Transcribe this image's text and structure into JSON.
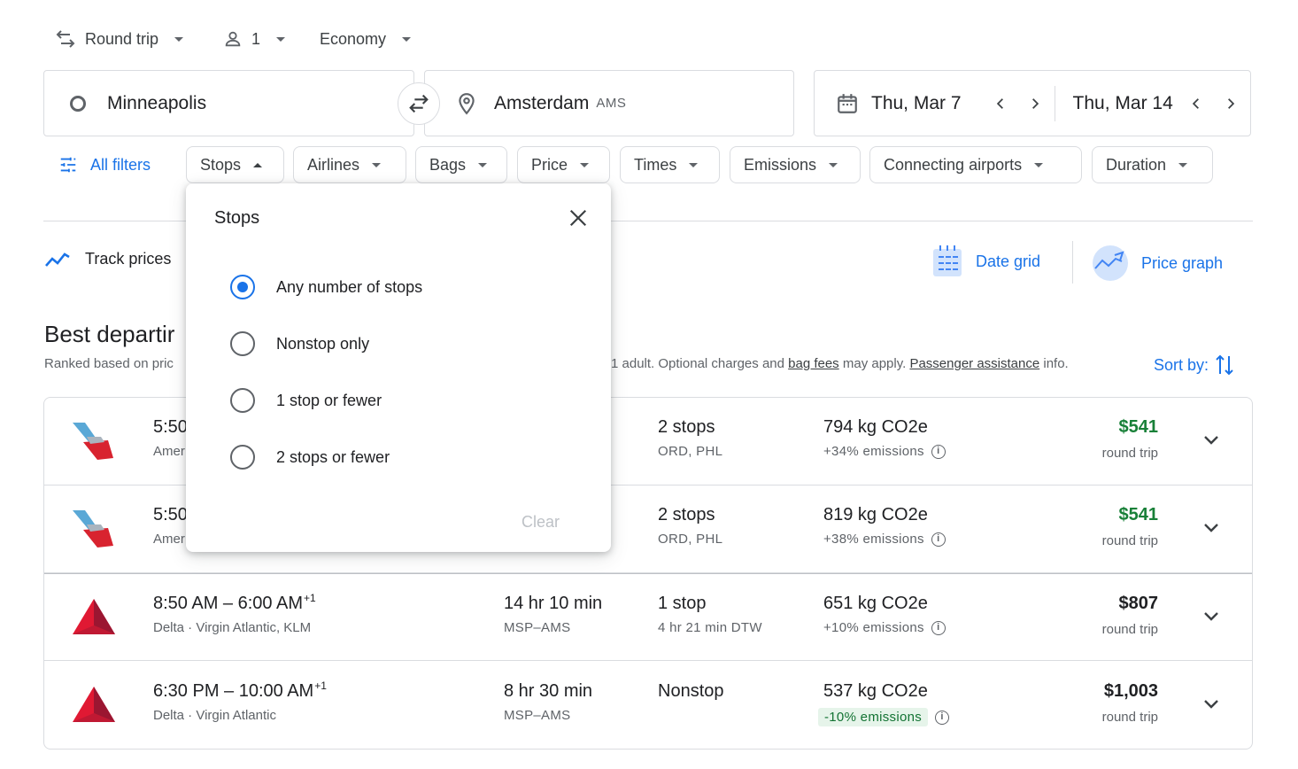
{
  "trip_options": {
    "trip_type": "Round trip",
    "passengers": "1",
    "cabin": "Economy"
  },
  "search": {
    "origin": "Minneapolis",
    "destination": "Amsterdam",
    "destination_code": "AMS",
    "depart_date": "Thu, Mar 7",
    "return_date": "Thu, Mar 14"
  },
  "filters": {
    "all_filters": "All filters",
    "chips": [
      "Stops",
      "Airlines",
      "Bags",
      "Price",
      "Times",
      "Emissions",
      "Connecting airports",
      "Duration"
    ]
  },
  "tools": {
    "track_prices": "Track prices",
    "date_grid": "Date grid",
    "price_graph": "Price graph"
  },
  "results_header": {
    "title": "Best departir",
    "ranked_prefix": "Ranked based on pric",
    "ranked_suffix_1": "1 adult. Optional charges and ",
    "bag_fees": "bag fees",
    "ranked_suffix_2": " may apply. ",
    "passenger_assistance": "Passenger assistance",
    "ranked_suffix_3": " info.",
    "sort_by": "Sort by:"
  },
  "flights": [
    {
      "times": "5:50",
      "plus": "",
      "airline": "Amer",
      "duration": "",
      "route": "",
      "stops": "2 stops",
      "stop_detail": "ORD, PHL",
      "co2": "794 kg CO2e",
      "emissions": "+34% emissions",
      "price": "$541",
      "price_type": "round trip"
    },
    {
      "times": "5:50",
      "plus": "",
      "airline": "Amer",
      "duration": "",
      "route": "",
      "stops": "2 stops",
      "stop_detail": "ORD, PHL",
      "co2": "819 kg CO2e",
      "emissions": "+38% emissions",
      "price": "$541",
      "price_type": "round trip"
    },
    {
      "times": "8:50 AM – 6:00 AM",
      "plus": "+1",
      "airline": "Delta · Virgin Atlantic, KLM",
      "duration": "14 hr 10 min",
      "route": "MSP–AMS",
      "stops": "1 stop",
      "stop_detail": "4 hr 21 min DTW",
      "co2": "651 kg CO2e",
      "emissions": "+10% emissions",
      "price": "$807",
      "price_type": "round trip"
    },
    {
      "times": "6:30 PM – 10:00 AM",
      "plus": "+1",
      "airline": "Delta · Virgin Atlantic",
      "duration": "8 hr 30 min",
      "route": "MSP–AMS",
      "stops": "Nonstop",
      "stop_detail": "",
      "co2": "537 kg CO2e",
      "emissions": "-10% emissions",
      "price": "$1,003",
      "price_type": "round trip"
    }
  ],
  "stops_popover": {
    "title": "Stops",
    "options": [
      "Any number of stops",
      "Nonstop only",
      "1 stop or fewer",
      "2 stops or fewer"
    ],
    "selected": "Any number of stops",
    "clear": "Clear"
  },
  "colors": {
    "accent": "#1a73e8",
    "price_green": "#188038",
    "emission_badge_bg": "#e6f4ea",
    "emission_badge_text": "#137333"
  }
}
